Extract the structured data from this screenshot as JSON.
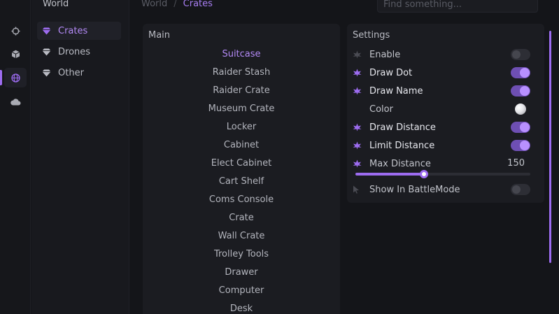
{
  "sidebar": {
    "title": "World",
    "items": [
      {
        "label": "Crates",
        "icon": "gem-icon",
        "active": true
      },
      {
        "label": "Drones",
        "icon": "gem-icon",
        "active": false
      },
      {
        "label": "Other",
        "icon": "gem-icon",
        "active": false
      }
    ]
  },
  "rail": {
    "icons": [
      "crosshair-icon",
      "cube-icon",
      "globe-icon",
      "cloud-icon"
    ],
    "active": "globe-icon"
  },
  "header": {
    "breadcrumb": [
      "World",
      "Crates"
    ],
    "separator": "/",
    "search_placeholder": "Find something..."
  },
  "main": {
    "title": "Main",
    "items": [
      "Suitcase",
      "Raider Stash",
      "Raider Crate",
      "Museum Crate",
      "Locker",
      "Cabinet",
      "Elect Cabinet",
      "Cart Shelf",
      "Coms Console",
      "Crate",
      "Wall Crate",
      "Trolley Tools",
      "Drawer",
      "Computer",
      "Desk"
    ],
    "active_index": 0
  },
  "settings": {
    "title": "Settings",
    "enable": {
      "label": "Enable",
      "on": false
    },
    "draw_dot": {
      "label": "Draw Dot",
      "on": true
    },
    "draw_name": {
      "label": "Draw Name",
      "on": true
    },
    "color": {
      "label": "Color",
      "value": "#f0f0f2"
    },
    "draw_distance": {
      "label": "Draw Distance",
      "on": true
    },
    "limit_distance": {
      "label": "Limit Distance",
      "on": true
    },
    "max_distance": {
      "label": "Max Distance",
      "value": "150",
      "fraction": 0.39
    },
    "battle_mode": {
      "label": "Show In BattleMode",
      "on": false
    }
  },
  "colors": {
    "accent": "#9d6cf0",
    "accent_text": "#b48af7",
    "background": "#141519",
    "panel": "#1b1c21"
  }
}
